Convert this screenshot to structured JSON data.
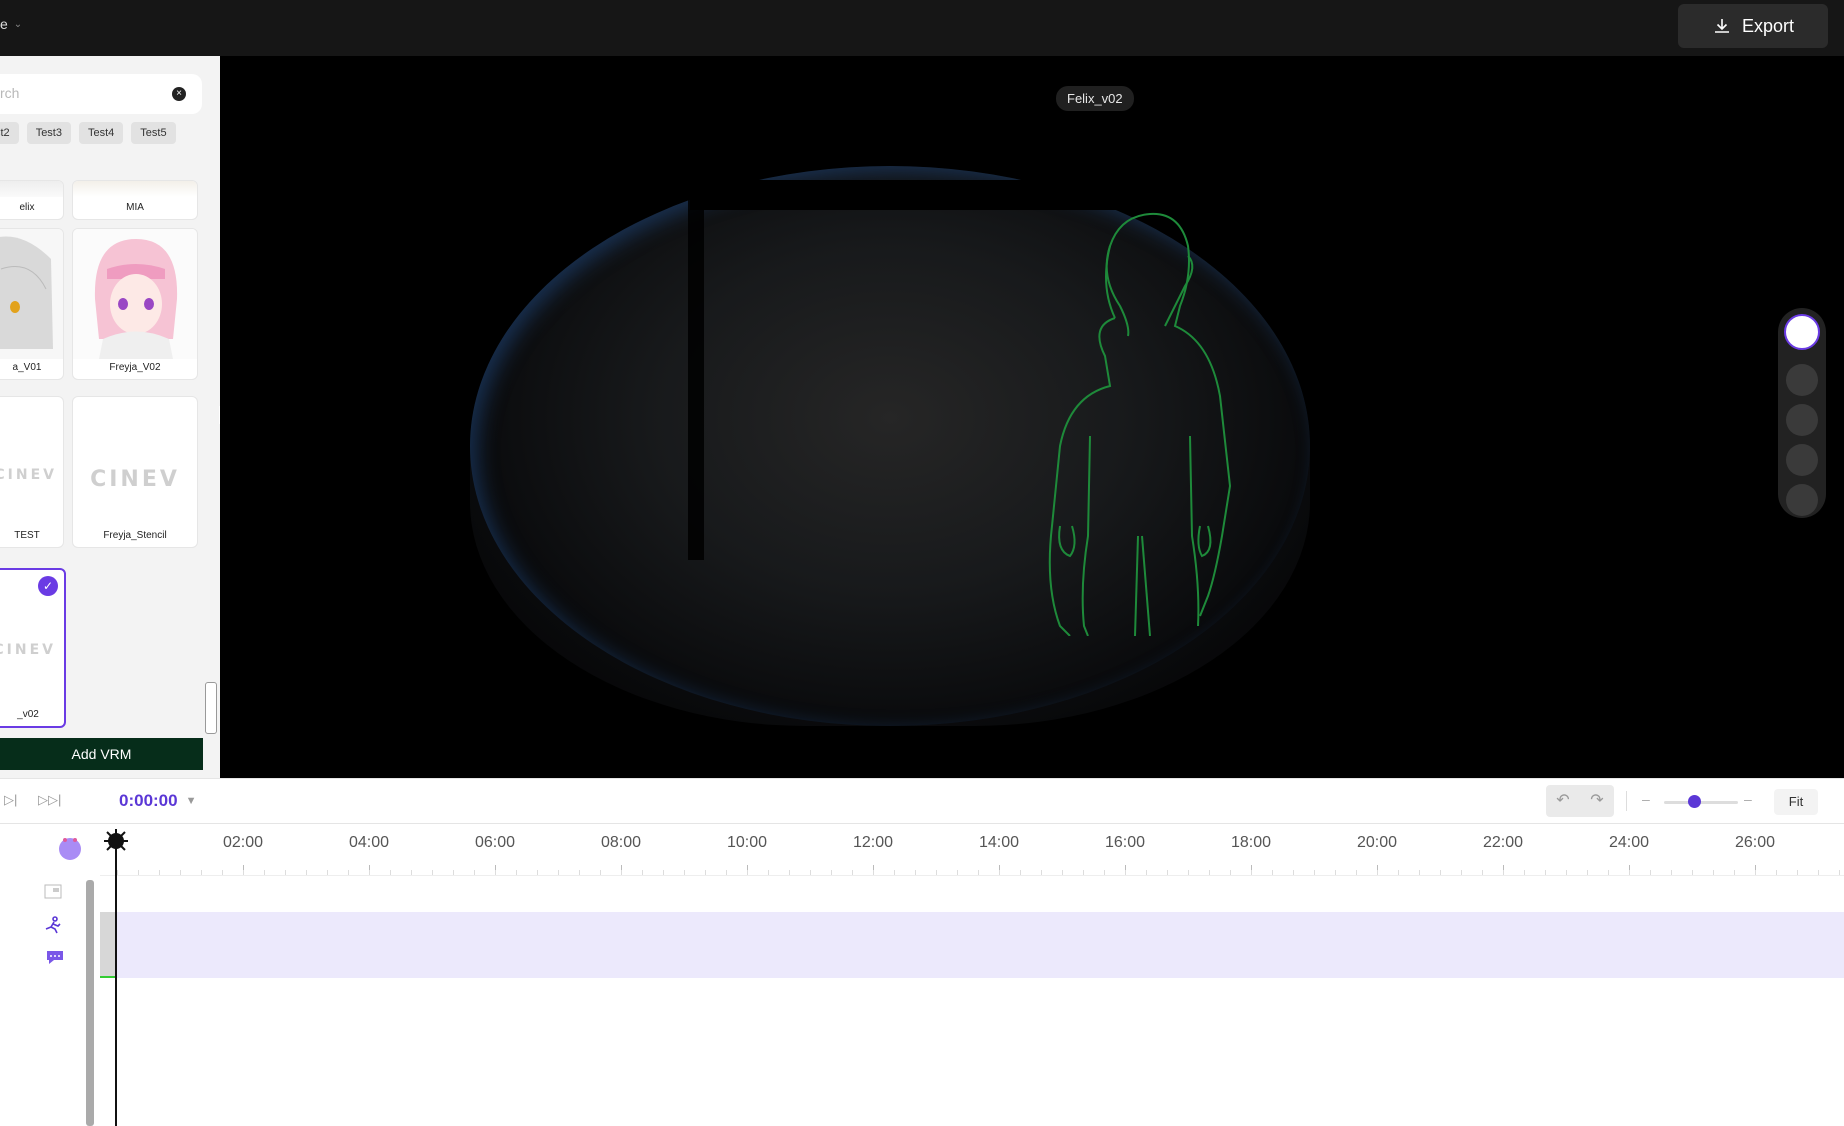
{
  "topbar": {
    "export_label": "Export"
  },
  "panel": {
    "search_placeholder": "rch",
    "tags": [
      "st2",
      "Test3",
      "Test4",
      "Test5"
    ],
    "cards": [
      {
        "name": "elix"
      },
      {
        "name": "MIA"
      },
      {
        "name": "a_V01"
      },
      {
        "name": "Freyja_V02"
      },
      {
        "name": "TEST"
      },
      {
        "name": "Freyja_Stencil"
      },
      {
        "name": "_v02"
      }
    ],
    "logo_text": "CINEV",
    "add_vrm_label": "Add VRM"
  },
  "viewport": {
    "selected_label": "Felix_v02"
  },
  "timeline": {
    "timecode": "0:00:00",
    "fit_label": "Fit",
    "ruler": [
      "02:00",
      "04:00",
      "06:00",
      "08:00",
      "10:00",
      "12:00",
      "14:00",
      "16:00",
      "18:00",
      "20:00",
      "22:00",
      "24:00",
      "26:00"
    ]
  },
  "colors": {
    "accent": "#6a3be4",
    "outline": "#1e8a3a",
    "add_vrm_bg": "#062d1a",
    "track_band": "#ece9fc"
  }
}
